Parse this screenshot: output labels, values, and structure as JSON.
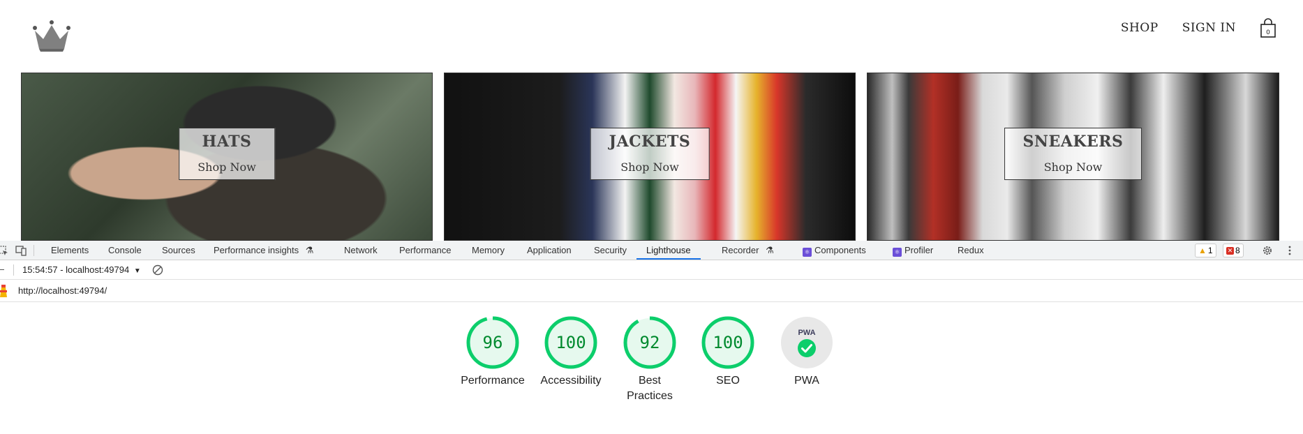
{
  "site": {
    "nav": {
      "shop": "SHOP",
      "sign_in": "SIGN IN"
    },
    "tiles": [
      {
        "title": "HATS",
        "cta": "Shop Now"
      },
      {
        "title": "JACKETS",
        "cta": "Shop Now"
      },
      {
        "title": "SNEAKERS",
        "cta": "Shop Now"
      }
    ]
  },
  "devtools": {
    "tabs": {
      "elements": "Elements",
      "console": "Console",
      "sources": "Sources",
      "performance_insights": "Performance insights",
      "network": "Network",
      "performance": "Performance",
      "memory": "Memory",
      "application": "Application",
      "security": "Security",
      "lighthouse": "Lighthouse",
      "recorder": "Recorder",
      "components": "Components",
      "profiler": "Profiler",
      "redux": "Redux"
    },
    "active_tab": "Lighthouse",
    "warnings_count": "1",
    "errors_count": "8",
    "report_selector": "15:54:57 - localhost:49794",
    "report_url": "http://localhost:49794/"
  },
  "lighthouse": {
    "scores": [
      {
        "score": "96",
        "value": 96,
        "label": "Performance"
      },
      {
        "score": "100",
        "value": 100,
        "label": "Accessibility"
      },
      {
        "score": "92",
        "value": 92,
        "label": "Best Practices"
      },
      {
        "score": "100",
        "value": 100,
        "label": "SEO"
      }
    ],
    "pwa": {
      "badge": "PWA",
      "label": "PWA"
    },
    "colors": {
      "pass": "#0cce6b",
      "pass_bg": "#e6f9ee",
      "score_text": "#008a2e",
      "pwa_bg": "#e8e8e8"
    }
  }
}
